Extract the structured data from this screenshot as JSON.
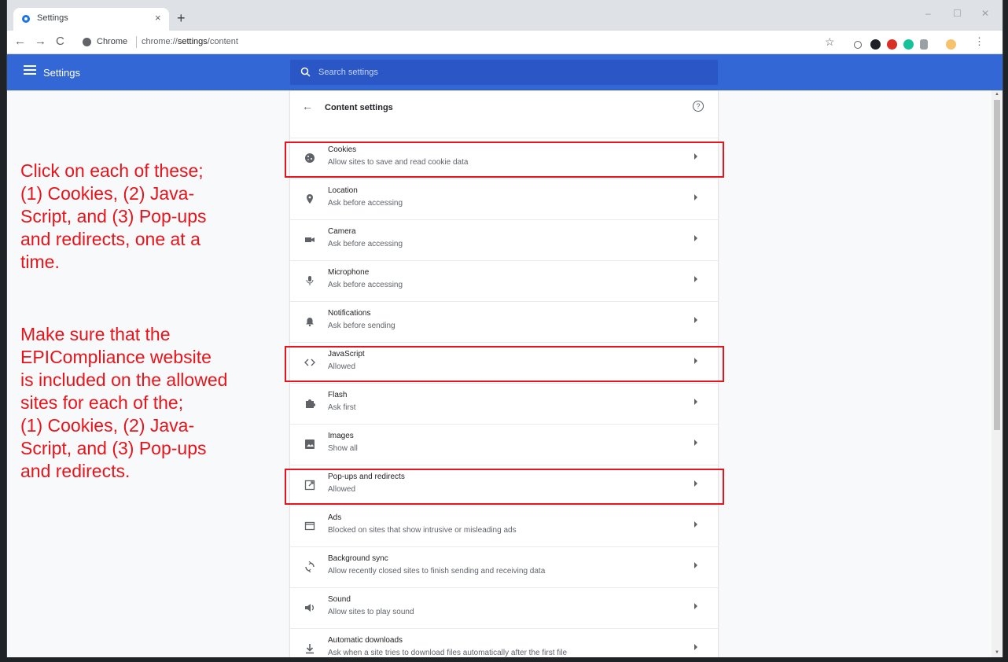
{
  "browser": {
    "tab_title": "Settings",
    "tab_close": "×",
    "new_tab": "+",
    "omnibox_site": "Chrome",
    "omnibox_url_prefix": "chrome://",
    "omnibox_url_bold": "settings",
    "omnibox_url_suffix": "/content",
    "window_controls": [
      "–",
      "☐",
      "✕"
    ]
  },
  "settings": {
    "app_title": "Settings",
    "search_placeholder": "Search settings",
    "page_title": "Content settings",
    "items": [
      {
        "icon": "cookie-icon",
        "title": "Cookies",
        "subtitle": "Allow sites to save and read cookie data",
        "highlighted": true
      },
      {
        "icon": "location-icon",
        "title": "Location",
        "subtitle": "Ask before accessing",
        "highlighted": false
      },
      {
        "icon": "camera-icon",
        "title": "Camera",
        "subtitle": "Ask before accessing",
        "highlighted": false
      },
      {
        "icon": "microphone-icon",
        "title": "Microphone",
        "subtitle": "Ask before accessing",
        "highlighted": false
      },
      {
        "icon": "bell-icon",
        "title": "Notifications",
        "subtitle": "Ask before sending",
        "highlighted": false
      },
      {
        "icon": "code-icon",
        "title": "JavaScript",
        "subtitle": "Allowed",
        "highlighted": true
      },
      {
        "icon": "puzzle-icon",
        "title": "Flash",
        "subtitle": "Ask first",
        "highlighted": false
      },
      {
        "icon": "image-icon",
        "title": "Images",
        "subtitle": "Show all",
        "highlighted": false
      },
      {
        "icon": "popup-icon",
        "title": "Pop-ups and redirects",
        "subtitle": "Allowed",
        "highlighted": true
      },
      {
        "icon": "ads-icon",
        "title": "Ads",
        "subtitle": "Blocked on sites that show intrusive or misleading ads",
        "highlighted": false
      },
      {
        "icon": "sync-icon",
        "title": "Background sync",
        "subtitle": "Allow recently closed sites to finish sending and receiving data",
        "highlighted": false
      },
      {
        "icon": "sound-icon",
        "title": "Sound",
        "subtitle": "Allow sites to play sound",
        "highlighted": false
      },
      {
        "icon": "download-icon",
        "title": "Automatic downloads",
        "subtitle": "Ask when a site tries to download files automatically after the first file",
        "highlighted": false
      }
    ]
  },
  "annotation": {
    "color": "#e8141b",
    "lines_1": [
      "Click on each of these;",
      "(1) Cookies, (2) Java-",
      "Script, and (3) Pop-ups",
      "and redirects, one at a",
      "time."
    ],
    "lines_2": [
      "Make sure that the",
      "EPICompliance website",
      "is included on the allowed",
      "sites for each of the;",
      "(1) Cookies, (2) Java-",
      "Script, and (3) Pop-ups",
      "and redirects."
    ]
  },
  "colors": {
    "accent": "#3367d6",
    "search_bg": "#2a56c6",
    "highlight": "#e8141b"
  }
}
